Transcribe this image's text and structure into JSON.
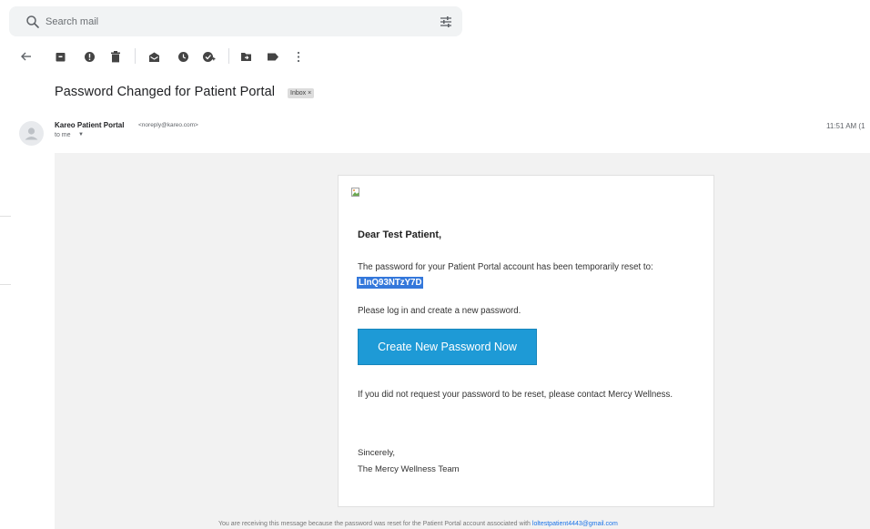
{
  "search": {
    "placeholder": "Search mail"
  },
  "toolbar": {
    "icons": [
      "back-arrow-icon",
      "archive-icon",
      "report-spam-icon",
      "delete-icon",
      "mark-unread-icon",
      "snooze-icon",
      "add-to-tasks-icon",
      "move-to-icon",
      "label-icon",
      "more-icon"
    ]
  },
  "message": {
    "subject": "Password Changed for Patient Portal",
    "label_chip": "Inbox ×",
    "sender_name": "Kareo Patient Portal",
    "sender_email": "<noreply@kareo.com>",
    "recipient": "to me",
    "time": "11:51 AM (1"
  },
  "email": {
    "greeting": "Dear Test Patient,",
    "reset_text": "The password for your Patient Portal account has been temporarily reset to:",
    "temp_password": "LInQ93NTzY7D",
    "login_text": "Please log in and create a new password.",
    "cta_label": "Create New Password Now",
    "notice": "If you did not request your password to be reset, please contact Mercy Wellness.",
    "signoff": "Sincerely,",
    "team": "The Mercy Wellness Team",
    "footer_text": "You are receiving this message because the password was reset for the Patient Portal account associated with ",
    "footer_email": "loltestpatient4443@gmail.com"
  },
  "colors": {
    "accent_blue": "#1e9ad6",
    "selection_blue": "#3478db",
    "body_bg": "#f2f2f2"
  }
}
